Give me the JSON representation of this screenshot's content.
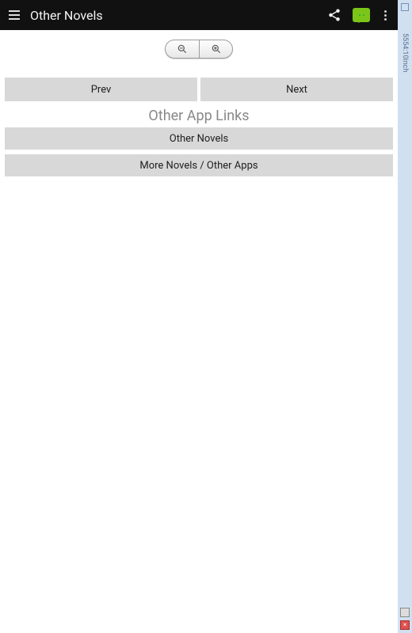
{
  "header": {
    "title": "Other Novels"
  },
  "nav": {
    "prev_label": "Prev",
    "next_label": "Next"
  },
  "section": {
    "title": "Other App Links",
    "links": {
      "other_novels": "Other Novels",
      "more_apps": "More Novels / Other Apps"
    }
  },
  "emulator": {
    "rail_label": "5554:10inch"
  }
}
